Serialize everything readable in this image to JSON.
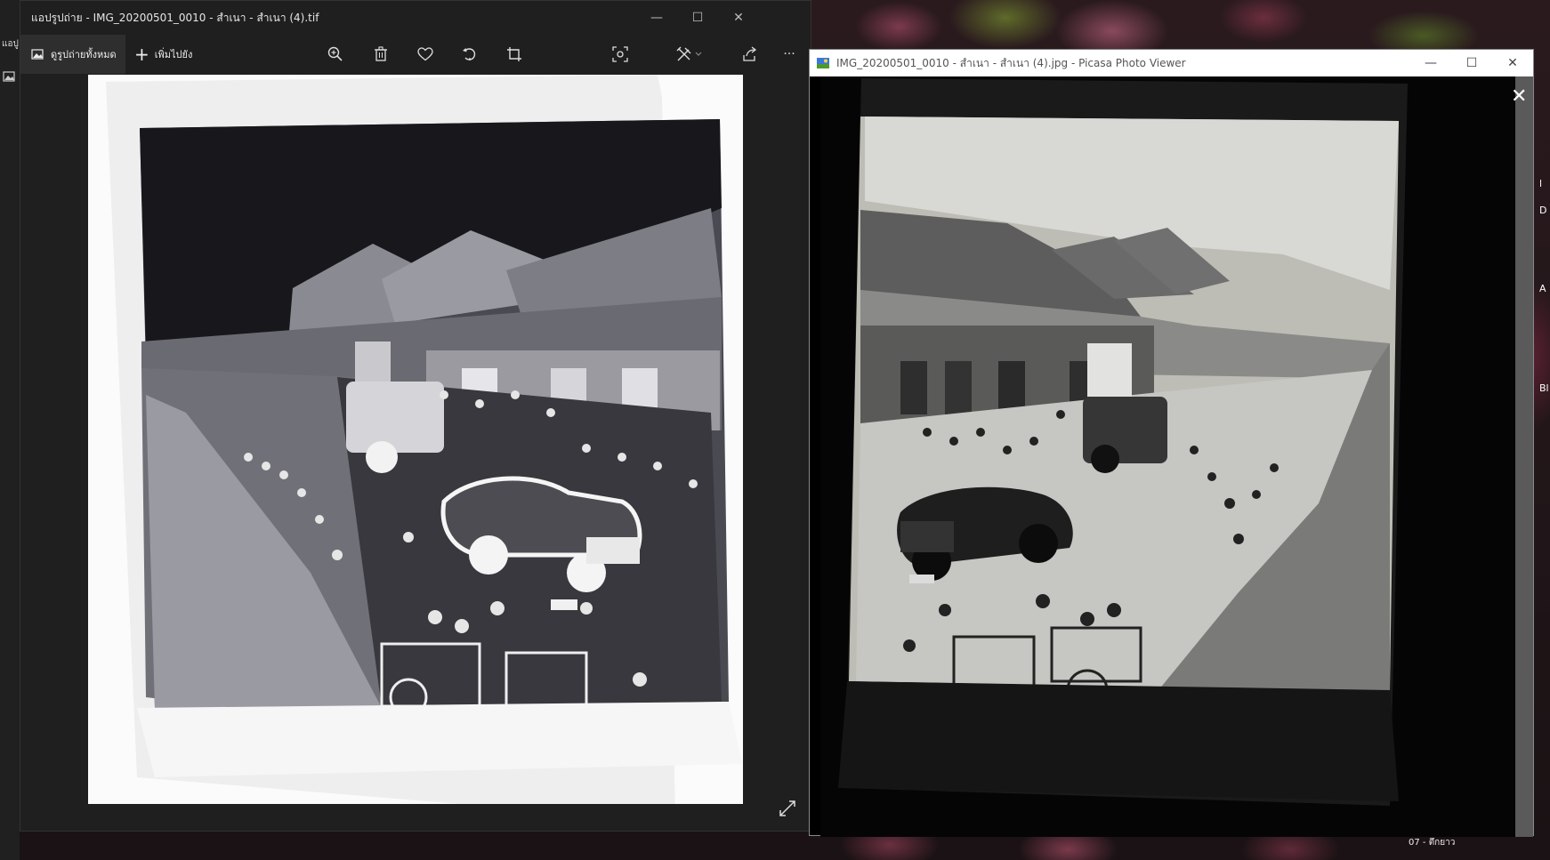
{
  "photos_window": {
    "app_tab_label": "แอปู",
    "title": "แอปรูปถ่าย - IMG_20200501_0010 - สำเนา - สำเนา (4).tif",
    "toolbar": {
      "view_all_label": "ดูรูปถ่ายทั้งหมด",
      "add_to_label": "เพิ่มไปยัง",
      "icons": [
        "zoom-in-icon",
        "delete-icon",
        "favorite-icon",
        "rotate-icon",
        "crop-icon",
        "spot-fix-icon",
        "edit-icon",
        "share-icon",
        "more-icon"
      ]
    },
    "more_label": "···"
  },
  "picasa_window": {
    "title": "IMG_20200501_0010 - สำเนา - สำเนา (4).jpg - Picasa Photo Viewer",
    "close_label": "✕"
  },
  "desktop": {
    "right_edge_labels": [
      "l",
      "D",
      "A",
      "Bl"
    ],
    "taskbar_date": "07 - ตึกยาว"
  },
  "colors": {
    "photos_bg": "#1f1f1f",
    "negative_paper": "#fafafa",
    "picasa_bg": "#000000"
  }
}
